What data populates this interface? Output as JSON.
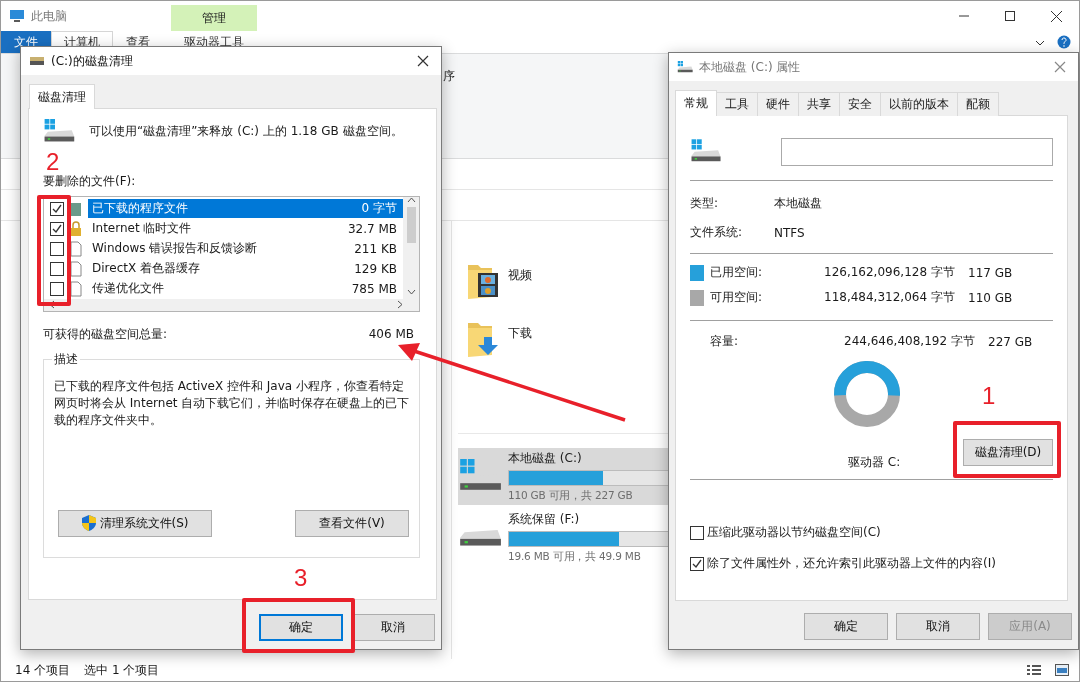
{
  "explorer": {
    "title": "此电脑",
    "ribbon_tabs": [
      {
        "label": "文件",
        "kind": "file",
        "selected": false
      },
      {
        "label": "计算机",
        "kind": "plain",
        "selected": true
      },
      {
        "label": "查看",
        "kind": "plain",
        "selected": false
      },
      {
        "label": "驱动器工具",
        "kind": "context",
        "selected": false
      }
    ],
    "context_group": "管理",
    "ribbon_fragment": "序",
    "folders": [
      {
        "name": "视频",
        "kind": "video"
      },
      {
        "name": "下载",
        "kind": "download"
      }
    ],
    "drives": [
      {
        "name": "本地磁盘 (C:)",
        "kind": "system",
        "level": 0.515,
        "free_text": "110 GB 可用，共 227 GB",
        "selected": true
      },
      {
        "name": "系统保留 (F:)",
        "kind": "plain",
        "level": 0.607,
        "free_text": "19.6 MB 可用，共 49.9 MB",
        "selected": false
      }
    ],
    "status_bar": {
      "count": "14 个项目",
      "selection": "选中 1 个项目"
    }
  },
  "cleanup_dialog": {
    "title": "(C:)的磁盘清理",
    "tab": "磁盘清理",
    "intro": "可以使用“磁盘清理”来释放 (C:) 上的 1.18 GB 磁盘空间。",
    "list_label": "要删除的文件(F):",
    "files": [
      {
        "name": "已下载的程序文件",
        "size": "0 字节",
        "kind": "folder",
        "checked": true,
        "selected": true
      },
      {
        "name": "Internet 临时文件",
        "size": "32.7 MB",
        "kind": "lock",
        "checked": true,
        "selected": false
      },
      {
        "name": "Windows 错误报告和反馈诊断",
        "size": "211 KB",
        "kind": "file",
        "checked": false,
        "selected": false
      },
      {
        "name": "DirectX 着色器缓存",
        "size": "129 KB",
        "kind": "file",
        "checked": false,
        "selected": false
      },
      {
        "name": "传递优化文件",
        "size": "785 MB",
        "kind": "file",
        "checked": false,
        "selected": false
      }
    ],
    "total_label": "可获得的磁盘空间总量:",
    "total_value": "406 MB",
    "description_title": "描述",
    "description": "已下载的程序文件包括 ActiveX 控件和 Java 小程序，你查看特定网页时将会从 Internet 自动下载它们，并临时保存在硬盘上的已下载的程序文件夹中。",
    "system_button": "清理系统文件(S)",
    "view_button": "查看文件(V)",
    "ok_button": "确定",
    "cancel_button": "取消"
  },
  "properties_dialog": {
    "title": "本地磁盘 (C:) 属性",
    "tabs": [
      {
        "label": "常规",
        "selected": true
      },
      {
        "label": "工具",
        "selected": false
      },
      {
        "label": "硬件",
        "selected": false
      },
      {
        "label": "共享",
        "selected": false
      },
      {
        "label": "安全",
        "selected": false
      },
      {
        "label": "以前的版本",
        "selected": false
      },
      {
        "label": "配额",
        "selected": false
      }
    ],
    "type_label": "类型:",
    "type_value": "本地磁盘",
    "fs_label": "文件系统:",
    "fs_value": "NTFS",
    "space": [
      {
        "label": "已用空间:",
        "bytes": "126,162,096,128 字节",
        "size": "117 GB",
        "color": "#26a0da"
      },
      {
        "label": "可用空间:",
        "bytes": "118,484,312,064 字节",
        "size": "110 GB",
        "color": "#a8a8a8"
      }
    ],
    "capacity_label": "容量:",
    "capacity_bytes": "244,646,408,192 字节",
    "capacity_size": "227 GB",
    "drive_label": "驱动器 C:",
    "cleanup_button": "磁盘清理(D)",
    "options": [
      {
        "label": "压缩此驱动器以节约磁盘空间(C)",
        "checked": false
      },
      {
        "label": "除了文件属性外，还允许索引此驱动器上文件的内容(I)",
        "checked": true
      }
    ],
    "buttons": [
      {
        "label": "确定",
        "disabled": false
      },
      {
        "label": "取消",
        "disabled": false
      },
      {
        "label": "应用(A)",
        "disabled": true
      }
    ]
  },
  "annotation_numbers": [
    "1",
    "2",
    "3"
  ]
}
